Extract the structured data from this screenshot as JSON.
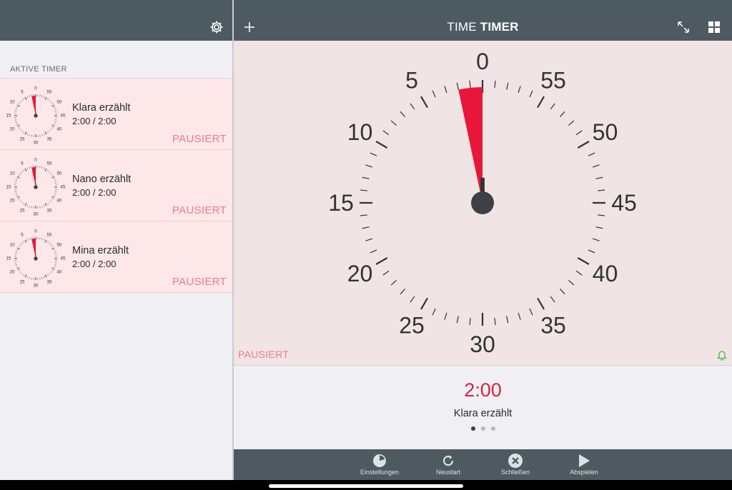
{
  "header": {
    "title_light": "TIME",
    "title_bold": "TIMER"
  },
  "sidebar": {
    "section_title": "AKTIVE TIMER",
    "timers": [
      {
        "name": "Klara erzählt",
        "time": "2:00 / 2:00",
        "status": "PAUSIERT"
      },
      {
        "name": "Nano erzählt",
        "time": "2:00 / 2:00",
        "status": "PAUSIERT"
      },
      {
        "name": "Mina erzählt",
        "time": "2:00 / 2:00",
        "status": "PAUSIERT"
      }
    ]
  },
  "dial": {
    "labels": [
      "0",
      "5",
      "10",
      "15",
      "20",
      "25",
      "30",
      "35",
      "40",
      "45",
      "50",
      "55"
    ],
    "mini_labels": [
      "0",
      "5",
      "10",
      "15",
      "20",
      "25",
      "30",
      "35",
      "40",
      "45",
      "50",
      "55"
    ],
    "remaining_minutes": 2,
    "wedge_color": "#e8173a",
    "status": "PAUSIERT"
  },
  "info": {
    "time": "2:00",
    "name": "Klara erzählt",
    "page_count": 3,
    "current_page": 1
  },
  "toolbar": {
    "settings": "Einstellungen",
    "restart": "Neustart",
    "close": "Schließen",
    "play": "Abspielen"
  },
  "icons": {
    "settings": "gear-icon",
    "add": "plus-icon",
    "fullscreen": "expand-icon",
    "grid": "grid-icon",
    "bell": "bell-icon"
  }
}
